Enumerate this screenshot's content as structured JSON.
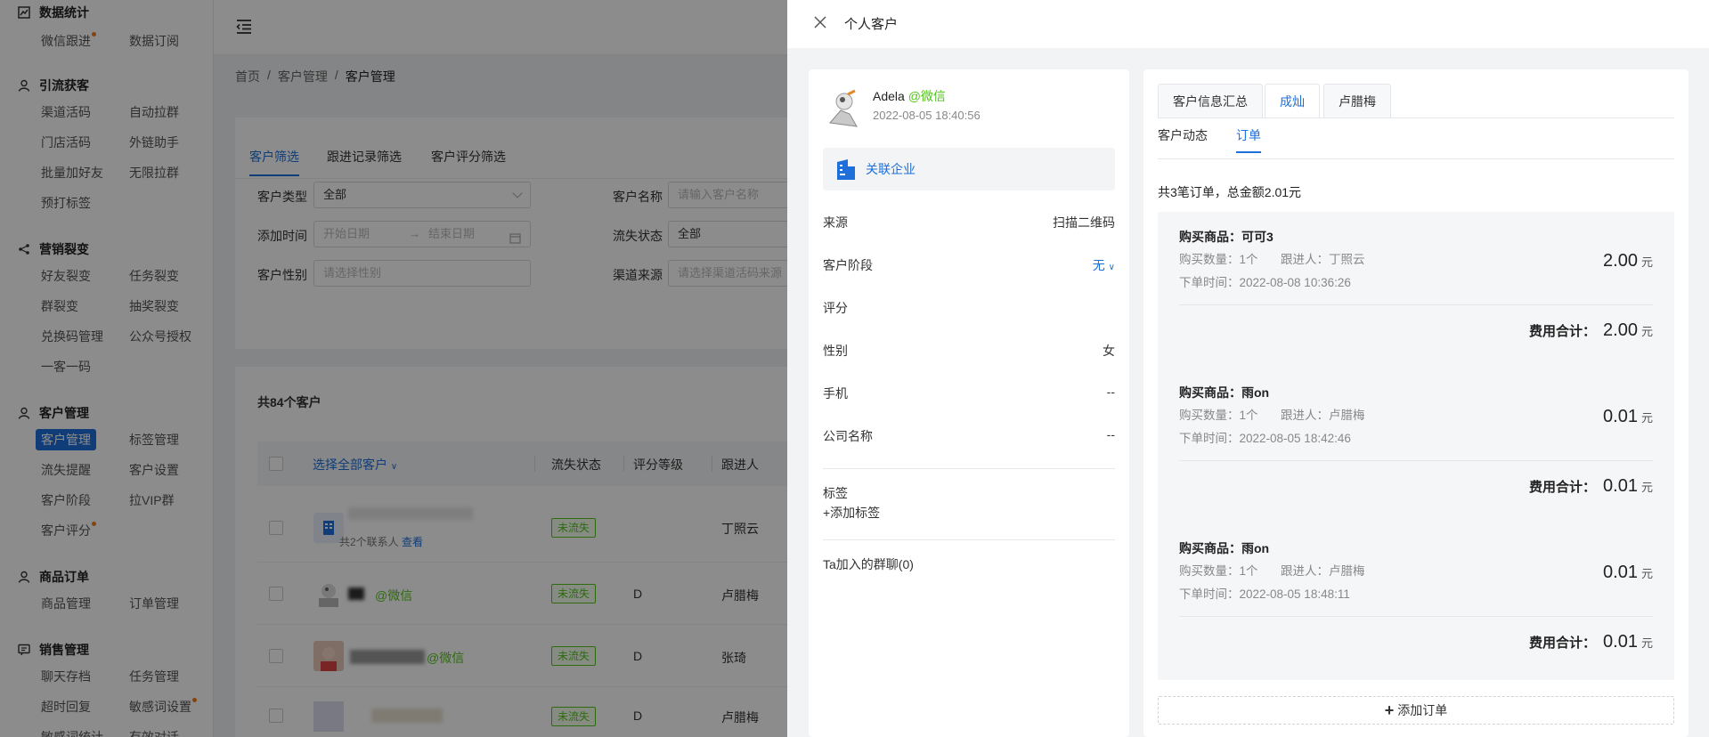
{
  "sidebar": {
    "groups": [
      {
        "title": "数据统计",
        "icon": "chart-icon",
        "items": [
          "微信跟进",
          "数据订阅"
        ]
      },
      {
        "title": "引流获客",
        "icon": "user-icon",
        "items": [
          "渠道活码",
          "自动拉群",
          "门店活码",
          "外链助手",
          "批量加好友",
          "无限拉群",
          "预打标签"
        ]
      },
      {
        "title": "营销裂变",
        "icon": "share-icon",
        "items": [
          "好友裂变",
          "任务裂变",
          "群裂变",
          "抽奖裂变",
          "兑换码管理",
          "公众号授权",
          "一客一码"
        ]
      },
      {
        "title": "客户管理",
        "icon": "user-icon",
        "items": [
          "客户管理",
          "标签管理",
          "流失提醒",
          "客户设置",
          "客户阶段",
          "拉VIP群",
          "客户评分"
        ]
      },
      {
        "title": "商品订单",
        "icon": "user-icon",
        "items": [
          "商品管理",
          "订单管理"
        ]
      },
      {
        "title": "销售管理",
        "icon": "chat-icon",
        "items": [
          "聊天存档",
          "任务管理",
          "超时回复",
          "敏感词设置",
          "敏感词统计",
          "有效对话"
        ]
      }
    ]
  },
  "breadcrumb": {
    "home": "首页",
    "level1": "客户管理",
    "current": "客户管理",
    "sep": "/"
  },
  "filter": {
    "tabs": [
      "客户筛选",
      "跟进记录筛选",
      "客户评分筛选"
    ],
    "customer_type_label": "客户类型",
    "customer_type_value": "全部",
    "customer_name_label": "客户名称",
    "customer_name_placeholder": "请输入客户名称",
    "add_time_label": "添加时间",
    "start_date_placeholder": "开始日期",
    "end_date_placeholder": "结束日期",
    "churn_status_label": "流失状态",
    "churn_status_value": "全部",
    "gender_label": "客户性别",
    "gender_placeholder": "请选择性别",
    "channel_label": "渠道来源",
    "channel_placeholder": "请选择渠道活码来源"
  },
  "list": {
    "count_text": "共84个客户",
    "select_all": "选择全部客户",
    "columns": [
      "流失状态",
      "评分等级",
      "跟进人"
    ],
    "rows": [
      {
        "sub": "共2个联系人",
        "view": "查看",
        "status": "未流失",
        "grade": "",
        "owner": "丁照云"
      },
      {
        "wechat": "@微信",
        "status": "未流失",
        "grade": "D",
        "owner": "卢腊梅"
      },
      {
        "wechat": "@微信",
        "status": "未流失",
        "grade": "D",
        "owner": "张琦"
      },
      {
        "status": "未流失",
        "grade": "D",
        "owner": "卢腊梅"
      }
    ]
  },
  "drawer": {
    "title": "个人客户",
    "profile": {
      "name": "Adela",
      "source_tag": "@微信",
      "time": "2022-08-05 18:40:56",
      "link_company": "关联企业"
    },
    "fields": [
      {
        "label": "来源",
        "value": "扫描二维码"
      },
      {
        "label": "客户阶段",
        "value": "无"
      },
      {
        "label": "评分",
        "value": ""
      },
      {
        "label": "性别",
        "value": "女"
      },
      {
        "label": "手机",
        "value": "--"
      },
      {
        "label": "公司名称",
        "value": "--"
      }
    ],
    "tags_label": "标签",
    "add_tag": "+添加标签",
    "groups_label": "Ta加入的群聊(0)",
    "top_tabs": [
      "客户信息汇总",
      "成灿",
      "卢腊梅"
    ],
    "sub_tabs": [
      "客户动态",
      "订单"
    ],
    "order_summary": "共3笔订单，总金额2.01元",
    "orders": [
      {
        "product": "购买商品：可可3",
        "qty": "购买数量：1个",
        "follower": "跟进人：丁照云",
        "time": "下单时间：2022-08-08 10:36:26",
        "amount": "2.00",
        "total": "2.00"
      },
      {
        "product": "购买商品：雨on",
        "qty": "购买数量：1个",
        "follower": "跟进人：卢腊梅",
        "time": "下单时间：2022-08-05 18:42:46",
        "amount": "0.01",
        "total": "0.01"
      },
      {
        "product": "购买商品：雨on",
        "qty": "购买数量：1个",
        "follower": "跟进人：卢腊梅",
        "time": "下单时间：2022-08-05 18:48:11",
        "amount": "0.01",
        "total": "0.01"
      }
    ],
    "unit": "元",
    "total_label": "费用合计：",
    "add_order": "添加订单"
  },
  "colors": {
    "accent": "#1e6fd9",
    "success": "#52c41a",
    "dot": "#f07c1b"
  }
}
